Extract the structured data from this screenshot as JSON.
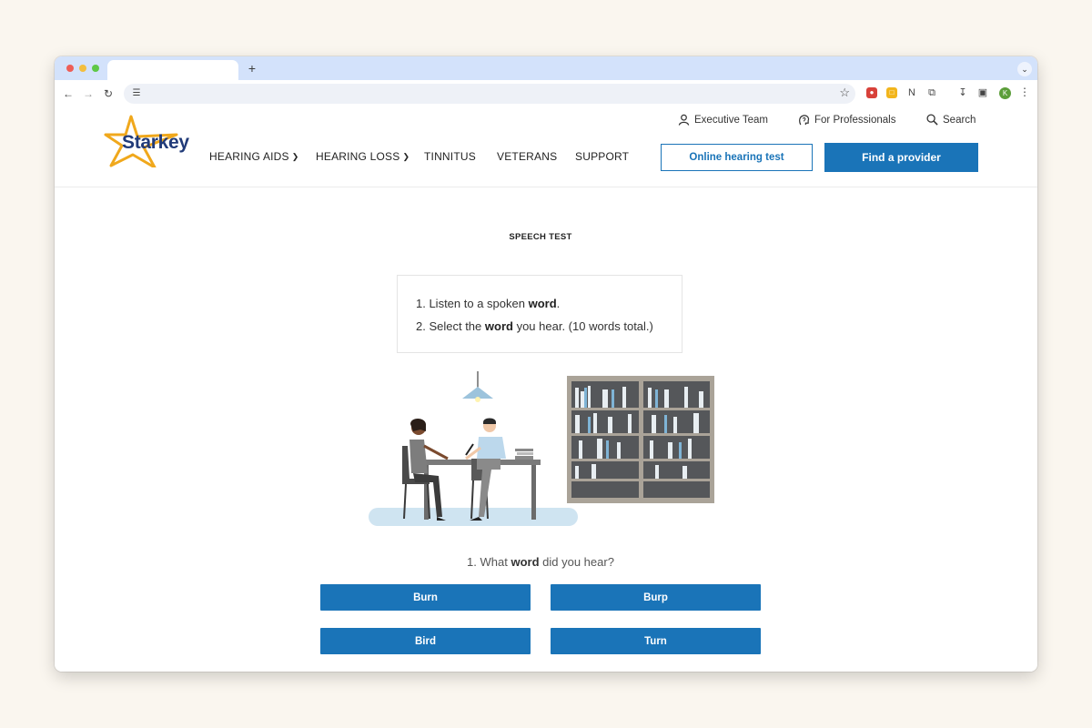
{
  "browser": {
    "new_tab_label": "+",
    "profile_initial": "K"
  },
  "header": {
    "logo_text": "Starkey",
    "util_links": {
      "executive_team": "Executive Team",
      "for_professionals": "For Professionals",
      "search": "Search"
    },
    "nav": {
      "hearing_aids": "HEARING AIDS",
      "hearing_loss": "HEARING LOSS",
      "tinnitus": "TINNITUS",
      "veterans": "VETERANS",
      "support": "SUPPORT"
    },
    "cta_outline": "Online hearing test",
    "cta_solid": "Find a provider"
  },
  "main": {
    "eyebrow": "SPEECH TEST",
    "instructions": {
      "step1_pre": "1. Listen to a spoken ",
      "step1_bold": "word",
      "step1_post": ".",
      "step2_pre": "2. Select the ",
      "step2_bold": "word",
      "step2_post": " you hear. (10 words total.)"
    },
    "question": {
      "pre": "1. What ",
      "bold": "word",
      "post": " did you hear?"
    },
    "answers": [
      "Burn",
      "Burp",
      "Bird",
      "Turn"
    ]
  },
  "colors": {
    "brand_blue": "#1a74b8",
    "logo_navy": "#213b79",
    "logo_gold": "#f0a81c",
    "floor_blue": "#cfe4f1"
  },
  "icons": {
    "executive_team": "person-icon",
    "for_professionals": "head-hearing-icon",
    "search": "search-icon"
  }
}
